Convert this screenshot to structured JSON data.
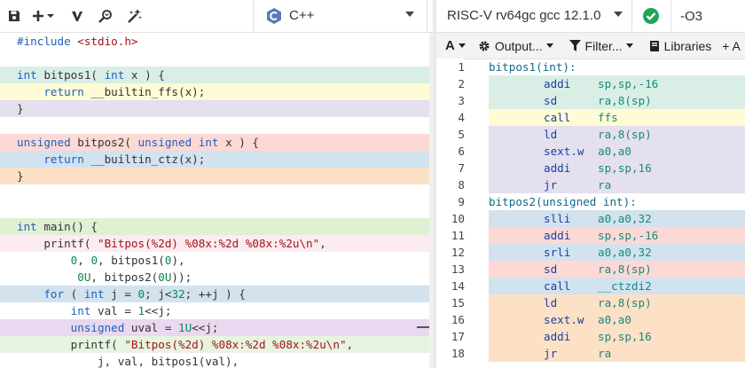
{
  "colors": {
    "teal": "#d9efe6",
    "yellow": "#fefbd5",
    "lavender": "#e4e0ee",
    "pink": "#fcd9d5",
    "blue": "#d2e2ef",
    "peach": "#fce1c6",
    "green": "#e0f0d3",
    "rose": "#fcebf1",
    "purple": "#e9d8ef",
    "mint": "#e6f4e1"
  },
  "editor": {
    "language": "C++",
    "icons": [
      "save-icon",
      "add-icon",
      "vim-icon",
      "search-icon",
      "wand-icon"
    ],
    "lines": [
      {
        "bg": "",
        "indent": "",
        "tokens": [
          {
            "c": "pp",
            "t": "#include "
          },
          {
            "c": "str",
            "t": "<stdio.h>"
          }
        ]
      },
      {
        "bg": "",
        "indent": "",
        "tokens": []
      },
      {
        "bg": "teal",
        "indent": "",
        "tokens": [
          {
            "c": "kw",
            "t": "int"
          },
          {
            "c": "",
            "t": " bitpos1( "
          },
          {
            "c": "kw",
            "t": "int"
          },
          {
            "c": "",
            "t": " x ) {"
          }
        ]
      },
      {
        "bg": "yellow",
        "indent": "    ",
        "tokens": [
          {
            "c": "kw",
            "t": "return"
          },
          {
            "c": "",
            "t": " __builtin_ffs(x);"
          }
        ]
      },
      {
        "bg": "lavender",
        "indent": "",
        "tokens": [
          {
            "c": "",
            "t": "}"
          }
        ]
      },
      {
        "bg": "",
        "indent": "",
        "tokens": []
      },
      {
        "bg": "pink",
        "indent": "",
        "tokens": [
          {
            "c": "kw",
            "t": "unsigned"
          },
          {
            "c": "",
            "t": " bitpos2( "
          },
          {
            "c": "kw",
            "t": "unsigned int"
          },
          {
            "c": "",
            "t": " x ) {"
          }
        ]
      },
      {
        "bg": "blue",
        "indent": "    ",
        "tokens": [
          {
            "c": "kw",
            "t": "return"
          },
          {
            "c": "",
            "t": " __builtin_ctz(x);"
          }
        ]
      },
      {
        "bg": "peach",
        "indent": "",
        "tokens": [
          {
            "c": "",
            "t": "}"
          }
        ]
      },
      {
        "bg": "",
        "indent": "",
        "tokens": []
      },
      {
        "bg": "",
        "indent": "",
        "tokens": []
      },
      {
        "bg": "green",
        "indent": "",
        "tokens": [
          {
            "c": "kw",
            "t": "int"
          },
          {
            "c": "",
            "t": " main() {"
          }
        ]
      },
      {
        "bg": "rose",
        "indent": "    ",
        "tokens": [
          {
            "c": "",
            "t": "printf( "
          },
          {
            "c": "str",
            "t": "\"Bitpos(%2d) %08x:%2d %08x:%2u\\n\""
          },
          {
            "c": "",
            "t": ","
          }
        ]
      },
      {
        "bg": "",
        "indent": "        ",
        "tokens": [
          {
            "c": "num",
            "t": "0"
          },
          {
            "c": "",
            "t": ", "
          },
          {
            "c": "num",
            "t": "0"
          },
          {
            "c": "",
            "t": ", bitpos1("
          },
          {
            "c": "num",
            "t": "0"
          },
          {
            "c": "",
            "t": "),"
          }
        ]
      },
      {
        "bg": "",
        "indent": "         ",
        "tokens": [
          {
            "c": "num",
            "t": "0U"
          },
          {
            "c": "",
            "t": ", bitpos2("
          },
          {
            "c": "num",
            "t": "0U"
          },
          {
            "c": "",
            "t": "));"
          }
        ]
      },
      {
        "bg": "blue",
        "indent": "    ",
        "tokens": [
          {
            "c": "kw",
            "t": "for"
          },
          {
            "c": "",
            "t": " ( "
          },
          {
            "c": "kw",
            "t": "int"
          },
          {
            "c": "",
            "t": " j = "
          },
          {
            "c": "num",
            "t": "0"
          },
          {
            "c": "",
            "t": "; j<"
          },
          {
            "c": "num",
            "t": "32"
          },
          {
            "c": "",
            "t": "; ++j ) {"
          }
        ]
      },
      {
        "bg": "",
        "indent": "        ",
        "tokens": [
          {
            "c": "kw",
            "t": "int"
          },
          {
            "c": "",
            "t": " val = "
          },
          {
            "c": "num",
            "t": "1"
          },
          {
            "c": "",
            "t": "<<j;"
          }
        ]
      },
      {
        "bg": "purple",
        "indent": "        ",
        "tokens": [
          {
            "c": "kw",
            "t": "unsigned"
          },
          {
            "c": "",
            "t": " uval = "
          },
          {
            "c": "num",
            "t": "1U"
          },
          {
            "c": "",
            "t": "<<j;"
          }
        ]
      },
      {
        "bg": "mint",
        "indent": "        ",
        "tokens": [
          {
            "c": "",
            "t": "printf( "
          },
          {
            "c": "str",
            "t": "\"Bitpos(%2d) %08x:%2d %08x:%2u\\n\""
          },
          {
            "c": "",
            "t": ","
          }
        ]
      },
      {
        "bg": "",
        "indent": "            ",
        "tokens": [
          {
            "c": "",
            "t": "j, val, bitpos1(val),"
          }
        ]
      }
    ]
  },
  "compiler": {
    "name": "RISC-V rv64gc gcc 12.1.0",
    "options": "-O3",
    "status_icon": "check-circle-icon",
    "toolbar": {
      "font_button": "A",
      "output_button": "Output...",
      "filter_button": "Filter...",
      "libraries_button": "Libraries",
      "add_button": "+ A"
    }
  },
  "assembly": [
    {
      "n": "1",
      "bg": "",
      "label": "bitpos1(int):",
      "ins": "",
      "ops": ""
    },
    {
      "n": "2",
      "bg": "teal",
      "label": "",
      "ins": "addi",
      "ops": "sp,sp,-16"
    },
    {
      "n": "3",
      "bg": "teal",
      "label": "",
      "ins": "sd",
      "ops": "ra,8(sp)"
    },
    {
      "n": "4",
      "bg": "yellow",
      "label": "",
      "ins": "call",
      "ops": "ffs"
    },
    {
      "n": "5",
      "bg": "lavender",
      "label": "",
      "ins": "ld",
      "ops": "ra,8(sp)"
    },
    {
      "n": "6",
      "bg": "lavender",
      "label": "",
      "ins": "sext.w",
      "ops": "a0,a0"
    },
    {
      "n": "7",
      "bg": "lavender",
      "label": "",
      "ins": "addi",
      "ops": "sp,sp,16"
    },
    {
      "n": "8",
      "bg": "lavender",
      "label": "",
      "ins": "jr",
      "ops": "ra"
    },
    {
      "n": "9",
      "bg": "",
      "label": "bitpos2(unsigned int):",
      "ins": "",
      "ops": ""
    },
    {
      "n": "10",
      "bg": "blue",
      "label": "",
      "ins": "slli",
      "ops": "a0,a0,32"
    },
    {
      "n": "11",
      "bg": "pink",
      "label": "",
      "ins": "addi",
      "ops": "sp,sp,-16"
    },
    {
      "n": "12",
      "bg": "blue",
      "label": "",
      "ins": "srli",
      "ops": "a0,a0,32"
    },
    {
      "n": "13",
      "bg": "pink",
      "label": "",
      "ins": "sd",
      "ops": "ra,8(sp)"
    },
    {
      "n": "14",
      "bg": "blue",
      "label": "",
      "ins": "call",
      "ops": "__ctzdi2"
    },
    {
      "n": "15",
      "bg": "peach",
      "label": "",
      "ins": "ld",
      "ops": "ra,8(sp)"
    },
    {
      "n": "16",
      "bg": "peach",
      "label": "",
      "ins": "sext.w",
      "ops": "a0,a0"
    },
    {
      "n": "17",
      "bg": "peach",
      "label": "",
      "ins": "addi",
      "ops": "sp,sp,16"
    },
    {
      "n": "18",
      "bg": "peach",
      "label": "",
      "ins": "jr",
      "ops": "ra"
    }
  ]
}
